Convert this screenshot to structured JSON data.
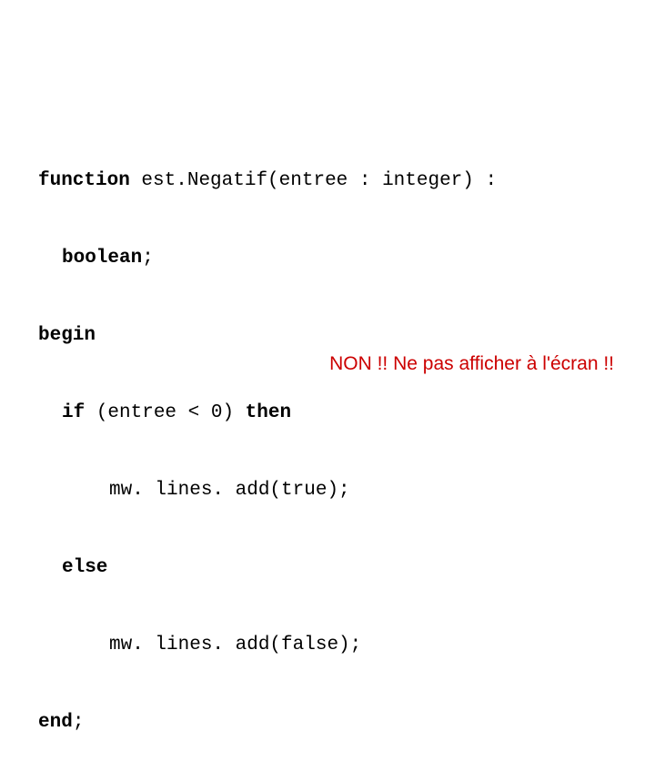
{
  "code": {
    "line1_kw1": "function",
    "line1_rest": " est.Negatif(entree : integer) : ",
    "line2_kw": "boolean",
    "line2_semi": "; ",
    "line3_kw": "begin",
    "line4_kw1": "if",
    "line4_mid": " (entree < 0) ",
    "line4_kw2": "then",
    "line5": "mw. lines. add(true); ",
    "line6_kw": "else",
    "line7": "mw. lines. add(false); ",
    "line8_kw": "end",
    "line8_semi": "; "
  },
  "warning_text": "NON !! Ne pas afficher à l'écran !! "
}
